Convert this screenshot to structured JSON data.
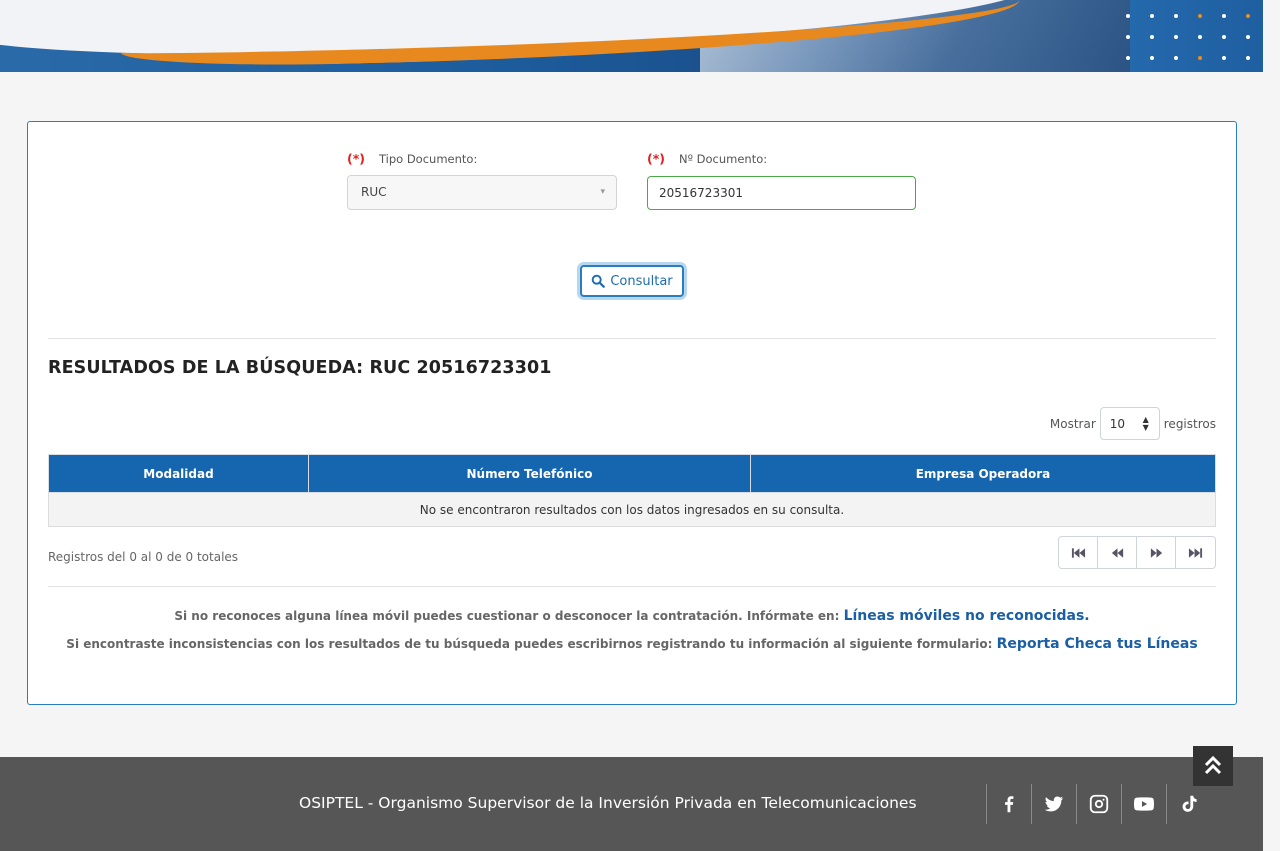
{
  "form": {
    "required_mark": "(*)",
    "tipo_label": "Tipo Documento:",
    "tipo_value": "RUC",
    "numero_label": "Nº Documento:",
    "numero_value": "20516723301",
    "consultar_label": "Consultar"
  },
  "results": {
    "title": "RESULTADOS DE LA BÚSQUEDA: RUC 20516723301",
    "mostrar_label": "Mostrar",
    "mostrar_value": "10",
    "registros_label": "registros",
    "columns": [
      "Modalidad",
      "Número Telefónico",
      "Empresa Operadora"
    ],
    "empty_message": "No se encontraron resultados con los datos ingresados en su consulta.",
    "summary": "Registros del 0 al 0 de 0 totales"
  },
  "notes": {
    "line1_text": "Si no reconoces alguna línea móvil puedes cuestionar o desconocer la contratación. Infórmate en:",
    "line1_link": "Líneas móviles no reconocidas.",
    "line2_text": "Si encontraste inconsistencias con los resultados de tu búsqueda puedes escribirnos registrando tu información al siguiente formulario:",
    "line2_link": "Reporta Checa tus Líneas"
  },
  "footer": {
    "text": "OSIPTEL - Organismo Supervisor de la Inversión Privada en Telecomunicaciones",
    "socials": [
      "facebook-icon",
      "twitter-icon",
      "instagram-icon",
      "youtube-icon",
      "tiktok-icon"
    ]
  },
  "colors": {
    "primary": "#1566ae",
    "required": "#e02020",
    "accent_orange": "#e8891f",
    "footer_bg": "#565656"
  }
}
